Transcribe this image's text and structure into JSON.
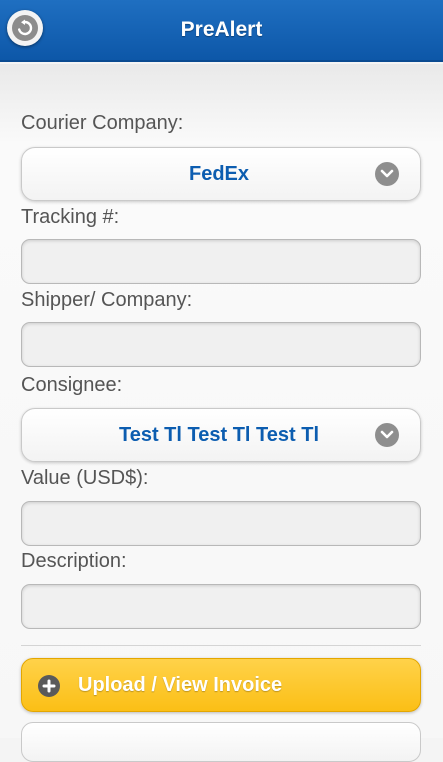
{
  "header": {
    "title": "PreAlert",
    "back_icon": "back-arrow-icon"
  },
  "form": {
    "courier": {
      "label": "Courier Company:",
      "value": "FedEx",
      "icon": "chevron-down-icon"
    },
    "tracking": {
      "label": "Tracking #:",
      "value": ""
    },
    "shipper": {
      "label": "Shipper/ Company:",
      "value": ""
    },
    "consignee": {
      "label": "Consignee:",
      "value": "Test Tl Test Tl Test Tl",
      "icon": "chevron-down-icon"
    },
    "value_usd": {
      "label": "Value (USD$):",
      "value": ""
    },
    "description": {
      "label": "Description:",
      "value": ""
    }
  },
  "actions": {
    "upload_label": "Upload / View Invoice",
    "upload_icon": "plus-icon"
  },
  "colors": {
    "header": "#1463b4",
    "accent_text": "#0c5db0",
    "upload_button": "#fcc425"
  }
}
